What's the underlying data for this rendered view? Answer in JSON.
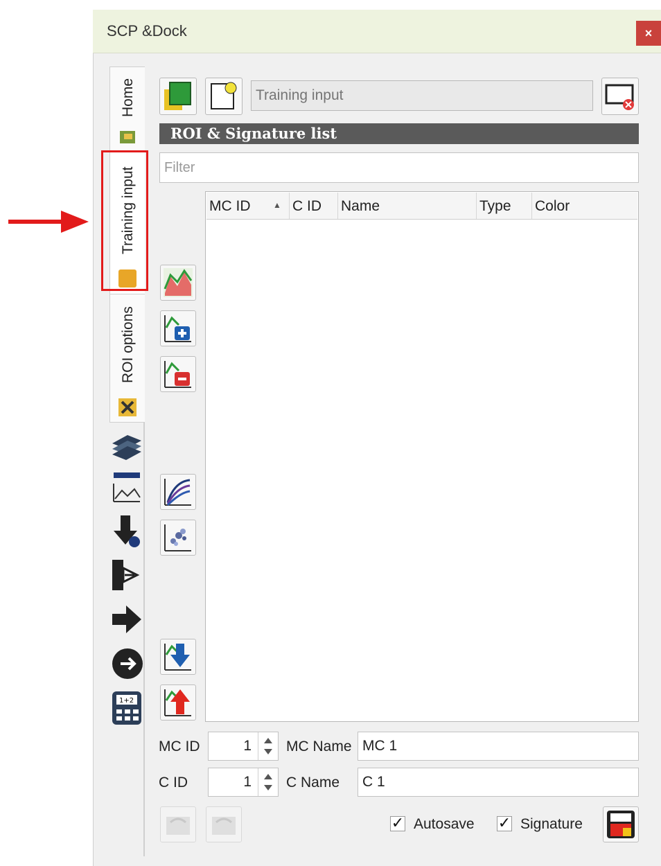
{
  "window": {
    "title": "SCP &Dock",
    "close_label": "×"
  },
  "tabs": [
    {
      "label": "Home",
      "icon": "home-tab-icon"
    },
    {
      "label": "Training input",
      "icon": "training-input-tab-icon"
    },
    {
      "label": "ROI options",
      "icon": "roi-options-tab-icon"
    }
  ],
  "toolbar": {
    "training_input_placeholder": "Training input"
  },
  "section_header": "ROI & Signature list",
  "filter": {
    "placeholder": "Filter"
  },
  "table": {
    "columns": [
      "MC ID",
      "C ID",
      "Name",
      "Type",
      "Color"
    ],
    "sort_indicator": "▲",
    "rows": []
  },
  "form": {
    "mc_id_label": "MC ID",
    "mc_id_value": "1",
    "mc_name_label": "MC Name",
    "mc_name_value": "MC 1",
    "c_id_label": "C ID",
    "c_id_value": "1",
    "c_name_label": "C Name",
    "c_name_value": "C 1",
    "autosave_label": "Autosave",
    "autosave_checked": true,
    "signature_label": "Signature",
    "signature_checked": true,
    "check_mark": "✓"
  },
  "colors": {
    "title_bg": "#eef3df",
    "close_bg": "#c9423c",
    "header_bg": "#5a5a5a",
    "highlight": "#e21b1b"
  }
}
